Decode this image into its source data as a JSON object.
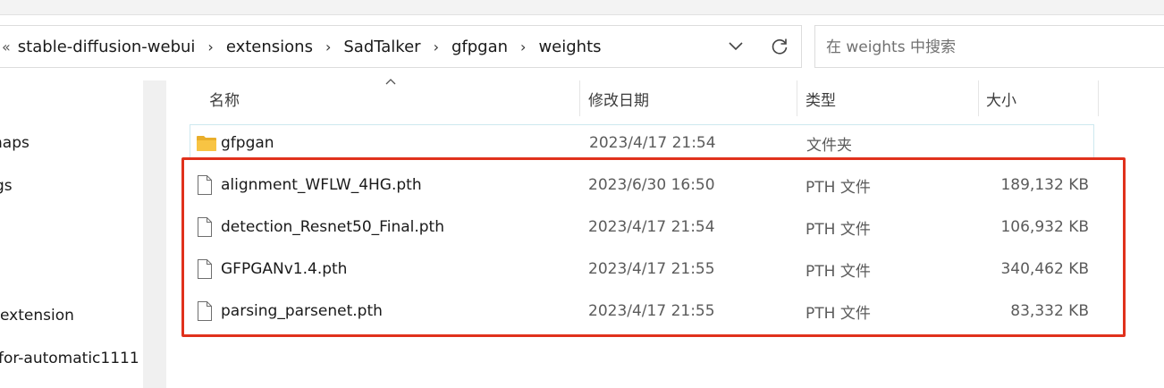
{
  "address_bar": {
    "overflow_glyph": "«",
    "crumbs": [
      "stable-diffusion-webui",
      "extensions",
      "SadTalker",
      "gfpgan",
      "weights"
    ]
  },
  "search": {
    "placeholder": "在 weights 中搜索"
  },
  "nav": {
    "items": [
      "naps",
      "gs",
      "extension",
      "for-automatic1111"
    ]
  },
  "columns": {
    "name": "名称",
    "modified": "修改日期",
    "type": "类型",
    "size": "大小"
  },
  "files": [
    {
      "name": "gfpgan",
      "modified": "2023/4/17 21:54",
      "type": "文件夹",
      "size": "",
      "icon": "folder-icon"
    },
    {
      "name": "alignment_WFLW_4HG.pth",
      "modified": "2023/6/30 16:50",
      "type": "PTH 文件",
      "size": "189,132 KB",
      "icon": "file-icon"
    },
    {
      "name": "detection_Resnet50_Final.pth",
      "modified": "2023/4/17 21:54",
      "type": "PTH 文件",
      "size": "106,932 KB",
      "icon": "file-icon"
    },
    {
      "name": "GFPGANv1.4.pth",
      "modified": "2023/4/17 21:55",
      "type": "PTH 文件",
      "size": "340,462 KB",
      "icon": "file-icon"
    },
    {
      "name": "parsing_parsenet.pth",
      "modified": "2023/4/17 21:55",
      "type": "PTH 文件",
      "size": "83,332 KB",
      "icon": "file-icon"
    }
  ],
  "colors": {
    "highlight": "#e0311c",
    "folder": "#f8c443",
    "selection_border": "#cde8ef"
  }
}
